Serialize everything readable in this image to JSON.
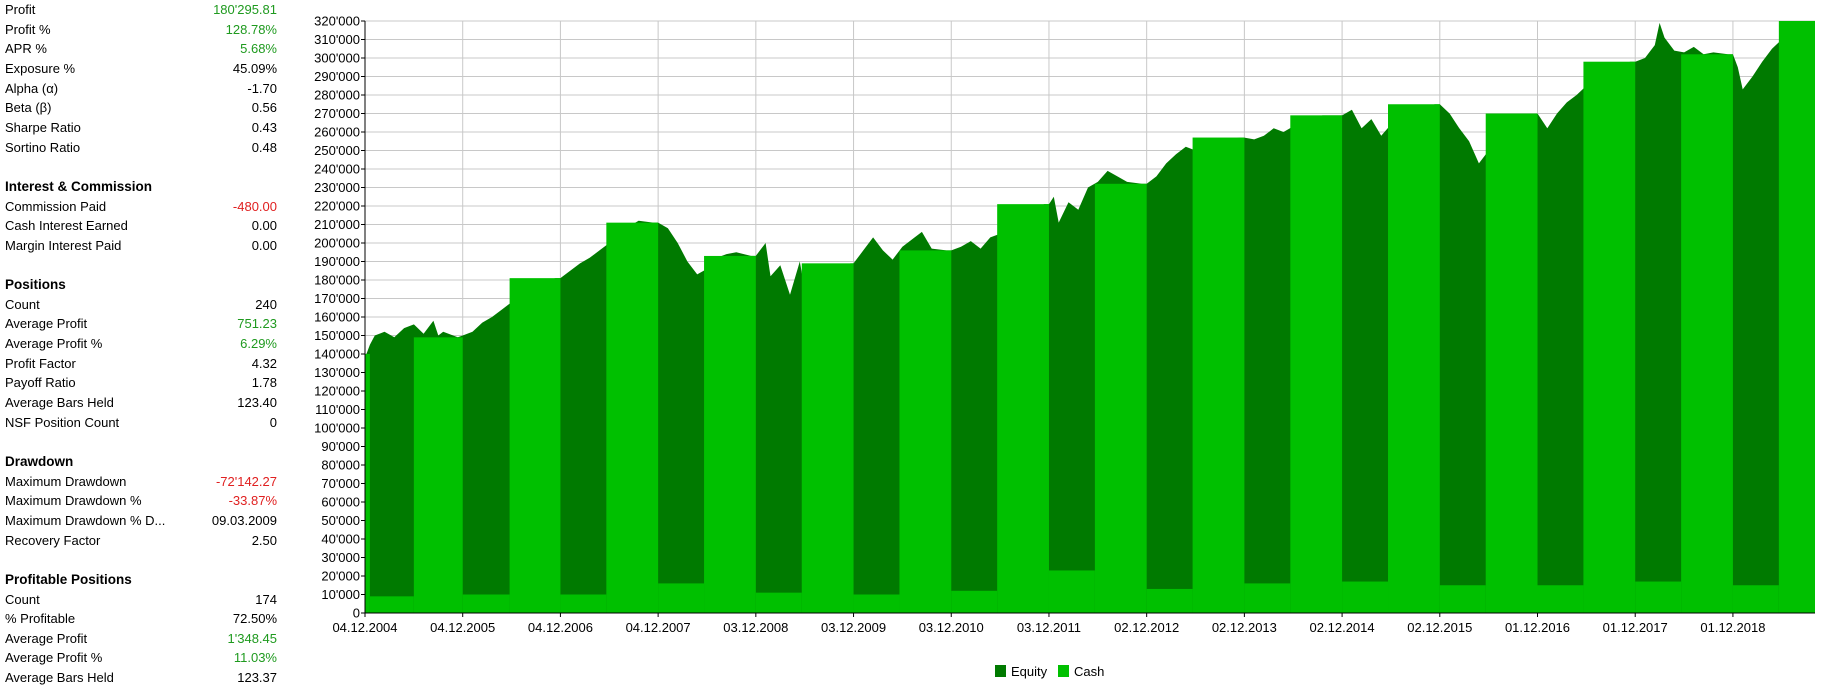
{
  "stats": {
    "top": [
      {
        "label": "Profit",
        "value": "180'295.81",
        "tone": "green"
      },
      {
        "label": "Profit %",
        "value": "128.78%",
        "tone": "green"
      },
      {
        "label": "APR %",
        "value": "5.68%",
        "tone": "green"
      },
      {
        "label": "Exposure %",
        "value": "45.09%",
        "tone": ""
      },
      {
        "label": "Alpha (α)",
        "value": "-1.70",
        "tone": ""
      },
      {
        "label": "Beta (β)",
        "value": "0.56",
        "tone": ""
      },
      {
        "label": "Sharpe Ratio",
        "value": "0.43",
        "tone": ""
      },
      {
        "label": "Sortino Ratio",
        "value": "0.48",
        "tone": ""
      }
    ],
    "interest": {
      "heading": "Interest & Commission",
      "rows": [
        {
          "label": "Commission Paid",
          "value": "-480.00",
          "tone": "red"
        },
        {
          "label": "Cash Interest Earned",
          "value": "0.00",
          "tone": ""
        },
        {
          "label": "Margin Interest Paid",
          "value": "0.00",
          "tone": ""
        }
      ]
    },
    "positions": {
      "heading": "Positions",
      "rows": [
        {
          "label": "Count",
          "value": "240",
          "tone": ""
        },
        {
          "label": "Average Profit",
          "value": "751.23",
          "tone": "green"
        },
        {
          "label": "Average Profit %",
          "value": "6.29%",
          "tone": "green"
        },
        {
          "label": "Profit Factor",
          "value": "4.32",
          "tone": ""
        },
        {
          "label": "Payoff Ratio",
          "value": "1.78",
          "tone": ""
        },
        {
          "label": "Average Bars Held",
          "value": "123.40",
          "tone": ""
        },
        {
          "label": "NSF Position Count",
          "value": "0",
          "tone": ""
        }
      ]
    },
    "drawdown": {
      "heading": "Drawdown",
      "rows": [
        {
          "label": "Maximum Drawdown",
          "value": "-72'142.27",
          "tone": "red"
        },
        {
          "label": "Maximum Drawdown %",
          "value": "-33.87%",
          "tone": "red"
        },
        {
          "label": "Maximum Drawdown % D...",
          "value": "09.03.2009",
          "tone": ""
        },
        {
          "label": "Recovery Factor",
          "value": "2.50",
          "tone": ""
        }
      ]
    },
    "profitable": {
      "heading": "Profitable Positions",
      "rows": [
        {
          "label": "Count",
          "value": "174",
          "tone": ""
        },
        {
          "label": "% Profitable",
          "value": "72.50%",
          "tone": ""
        },
        {
          "label": "Average Profit",
          "value": "1'348.45",
          "tone": "green"
        },
        {
          "label": "Average Profit %",
          "value": "11.03%",
          "tone": "green"
        },
        {
          "label": "Average Bars Held",
          "value": "123.37",
          "tone": ""
        }
      ]
    }
  },
  "chart_data": {
    "type": "area",
    "x_tick_labels": [
      "04.12.2004",
      "04.12.2005",
      "04.12.2006",
      "04.12.2007",
      "03.12.2008",
      "03.12.2009",
      "03.12.2010",
      "03.12.2011",
      "02.12.2012",
      "02.12.2013",
      "02.12.2014",
      "02.12.2015",
      "01.12.2016",
      "01.12.2017",
      "01.12.2018"
    ],
    "y_tick_labels": [
      "0",
      "10'000",
      "20'000",
      "30'000",
      "40'000",
      "50'000",
      "60'000",
      "70'000",
      "80'000",
      "90'000",
      "100'000",
      "110'000",
      "120'000",
      "130'000",
      "140'000",
      "150'000",
      "160'000",
      "170'000",
      "180'000",
      "190'000",
      "200'000",
      "210'000",
      "220'000",
      "230'000",
      "240'000",
      "250'000",
      "260'000",
      "270'000",
      "280'000",
      "290'000",
      "300'000",
      "310'000",
      "320'000"
    ],
    "ylim": [
      0,
      320000
    ],
    "grid": true,
    "legend_placement": "bottom-center",
    "legend": [
      {
        "name": "Equity",
        "color": "#007a00"
      },
      {
        "name": "Cash",
        "color": "#00c000"
      }
    ],
    "colors": {
      "equity": "#007a00",
      "cash": "#00c000"
    },
    "series": [
      {
        "name": "Equity",
        "points": [
          [
            0.0,
            138000
          ],
          [
            0.05,
            145000
          ],
          [
            0.1,
            150000
          ],
          [
            0.2,
            152000
          ],
          [
            0.3,
            149000
          ],
          [
            0.4,
            154000
          ],
          [
            0.5,
            156000
          ],
          [
            0.6,
            151000
          ],
          [
            0.7,
            158000
          ],
          [
            0.75,
            150000
          ],
          [
            0.8,
            152000
          ],
          [
            0.95,
            149000
          ],
          [
            1.0,
            150000
          ],
          [
            1.1,
            152000
          ],
          [
            1.2,
            157000
          ],
          [
            1.3,
            160000
          ],
          [
            1.4,
            164000
          ],
          [
            1.5,
            168000
          ],
          [
            1.6,
            173000
          ],
          [
            1.7,
            176000
          ],
          [
            1.8,
            179000
          ],
          [
            1.95,
            181000
          ],
          [
            2.0,
            181000
          ],
          [
            2.1,
            185000
          ],
          [
            2.2,
            189000
          ],
          [
            2.3,
            192000
          ],
          [
            2.4,
            196000
          ],
          [
            2.5,
            200000
          ],
          [
            2.6,
            205000
          ],
          [
            2.7,
            209000
          ],
          [
            2.8,
            212000
          ],
          [
            2.95,
            211000
          ],
          [
            3.0,
            211000
          ],
          [
            3.1,
            208000
          ],
          [
            3.2,
            200000
          ],
          [
            3.3,
            190000
          ],
          [
            3.4,
            183000
          ],
          [
            3.5,
            186000
          ],
          [
            3.6,
            192000
          ],
          [
            3.7,
            194000
          ],
          [
            3.8,
            195000
          ],
          [
            3.95,
            193000
          ],
          [
            4.0,
            193000
          ],
          [
            4.1,
            200000
          ],
          [
            4.15,
            182000
          ],
          [
            4.25,
            188000
          ],
          [
            4.35,
            172000
          ],
          [
            4.45,
            190000
          ],
          [
            4.55,
            160000
          ],
          [
            4.62,
            145000
          ],
          [
            4.7,
            160000
          ],
          [
            4.8,
            182000
          ],
          [
            4.9,
            188000
          ],
          [
            4.97,
            189000
          ],
          [
            5.0,
            189000
          ],
          [
            5.1,
            196000
          ],
          [
            5.2,
            203000
          ],
          [
            5.3,
            196000
          ],
          [
            5.4,
            191000
          ],
          [
            5.5,
            198000
          ],
          [
            5.6,
            202000
          ],
          [
            5.7,
            206000
          ],
          [
            5.8,
            197000
          ],
          [
            5.95,
            196000
          ],
          [
            6.0,
            196000
          ],
          [
            6.1,
            198000
          ],
          [
            6.2,
            201000
          ],
          [
            6.3,
            197000
          ],
          [
            6.4,
            203000
          ],
          [
            6.5,
            205000
          ],
          [
            6.6,
            208000
          ],
          [
            6.7,
            211000
          ],
          [
            6.8,
            216000
          ],
          [
            6.95,
            221000
          ],
          [
            7.0,
            221000
          ],
          [
            7.05,
            225000
          ],
          [
            7.1,
            211000
          ],
          [
            7.2,
            222000
          ],
          [
            7.3,
            218000
          ],
          [
            7.4,
            230000
          ],
          [
            7.5,
            233000
          ],
          [
            7.6,
            239000
          ],
          [
            7.7,
            236000
          ],
          [
            7.8,
            233000
          ],
          [
            7.95,
            232000
          ],
          [
            8.0,
            232000
          ],
          [
            8.1,
            236000
          ],
          [
            8.2,
            243000
          ],
          [
            8.3,
            248000
          ],
          [
            8.4,
            252000
          ],
          [
            8.5,
            250000
          ],
          [
            8.6,
            253000
          ],
          [
            8.7,
            255000
          ],
          [
            8.8,
            256000
          ],
          [
            8.95,
            257000
          ],
          [
            9.0,
            257000
          ],
          [
            9.1,
            256000
          ],
          [
            9.2,
            258000
          ],
          [
            9.3,
            262000
          ],
          [
            9.4,
            260000
          ],
          [
            9.5,
            263000
          ],
          [
            9.6,
            266000
          ],
          [
            9.7,
            268000
          ],
          [
            9.8,
            269000
          ],
          [
            9.95,
            269000
          ],
          [
            10.0,
            269000
          ],
          [
            10.1,
            272000
          ],
          [
            10.2,
            262000
          ],
          [
            10.3,
            267000
          ],
          [
            10.4,
            258000
          ],
          [
            10.5,
            264000
          ],
          [
            10.6,
            268000
          ],
          [
            10.7,
            270000
          ],
          [
            10.8,
            273000
          ],
          [
            10.95,
            275000
          ],
          [
            11.0,
            275000
          ],
          [
            11.1,
            270000
          ],
          [
            11.2,
            262000
          ],
          [
            11.3,
            255000
          ],
          [
            11.4,
            243000
          ],
          [
            11.5,
            250000
          ],
          [
            11.6,
            258000
          ],
          [
            11.7,
            266000
          ],
          [
            11.8,
            268000
          ],
          [
            11.95,
            270000
          ],
          [
            12.0,
            270000
          ],
          [
            12.1,
            262000
          ],
          [
            12.2,
            270000
          ],
          [
            12.3,
            276000
          ],
          [
            12.4,
            280000
          ],
          [
            12.5,
            285000
          ],
          [
            12.6,
            290000
          ],
          [
            12.7,
            293000
          ],
          [
            12.8,
            296000
          ],
          [
            12.95,
            298000
          ],
          [
            13.0,
            298000
          ],
          [
            13.1,
            300000
          ],
          [
            13.2,
            307000
          ],
          [
            13.25,
            319000
          ],
          [
            13.3,
            311000
          ],
          [
            13.4,
            304000
          ],
          [
            13.5,
            303000
          ],
          [
            13.6,
            306000
          ],
          [
            13.7,
            302000
          ],
          [
            13.8,
            303000
          ],
          [
            13.95,
            302000
          ],
          [
            14.0,
            302000
          ],
          [
            14.05,
            295000
          ],
          [
            14.1,
            283000
          ],
          [
            14.2,
            290000
          ],
          [
            14.3,
            298000
          ],
          [
            14.4,
            305000
          ],
          [
            14.5,
            310000
          ],
          [
            14.6,
            315000
          ],
          [
            14.7,
            320000
          ],
          [
            14.84,
            320000
          ]
        ]
      },
      {
        "name": "Cash",
        "segments": [
          {
            "x0": 0.0,
            "x1": 0.05,
            "value": 140000
          },
          {
            "x0": 0.05,
            "x1": 0.5,
            "value": 9000
          },
          {
            "x0": 0.5,
            "x1": 1.0,
            "value": 149000
          },
          {
            "x0": 1.0,
            "x1": 1.48,
            "value": 10000
          },
          {
            "x0": 1.48,
            "x1": 2.0,
            "value": 181000
          },
          {
            "x0": 2.0,
            "x1": 2.47,
            "value": 10000
          },
          {
            "x0": 2.47,
            "x1": 3.0,
            "value": 211000
          },
          {
            "x0": 3.0,
            "x1": 3.47,
            "value": 16000
          },
          {
            "x0": 3.47,
            "x1": 4.0,
            "value": 193000
          },
          {
            "x0": 4.0,
            "x1": 4.47,
            "value": 11000
          },
          {
            "x0": 4.47,
            "x1": 5.0,
            "value": 189000
          },
          {
            "x0": 5.0,
            "x1": 5.47,
            "value": 10000
          },
          {
            "x0": 5.47,
            "x1": 6.0,
            "value": 196000
          },
          {
            "x0": 6.0,
            "x1": 6.47,
            "value": 12000
          },
          {
            "x0": 6.47,
            "x1": 7.0,
            "value": 221000
          },
          {
            "x0": 7.0,
            "x1": 7.47,
            "value": 23000
          },
          {
            "x0": 7.47,
            "x1": 8.0,
            "value": 232000
          },
          {
            "x0": 8.0,
            "x1": 8.47,
            "value": 13000
          },
          {
            "x0": 8.47,
            "x1": 9.0,
            "value": 257000
          },
          {
            "x0": 9.0,
            "x1": 9.47,
            "value": 16000
          },
          {
            "x0": 9.47,
            "x1": 10.0,
            "value": 269000
          },
          {
            "x0": 10.0,
            "x1": 10.47,
            "value": 17000
          },
          {
            "x0": 10.47,
            "x1": 11.0,
            "value": 275000
          },
          {
            "x0": 11.0,
            "x1": 11.47,
            "value": 15000
          },
          {
            "x0": 11.47,
            "x1": 12.0,
            "value": 270000
          },
          {
            "x0": 12.0,
            "x1": 12.47,
            "value": 15000
          },
          {
            "x0": 12.47,
            "x1": 13.0,
            "value": 298000
          },
          {
            "x0": 13.0,
            "x1": 13.47,
            "value": 17000
          },
          {
            "x0": 13.47,
            "x1": 14.0,
            "value": 302000
          },
          {
            "x0": 14.0,
            "x1": 14.47,
            "value": 15000
          },
          {
            "x0": 14.47,
            "x1": 14.84,
            "value": 320000
          }
        ]
      }
    ]
  }
}
